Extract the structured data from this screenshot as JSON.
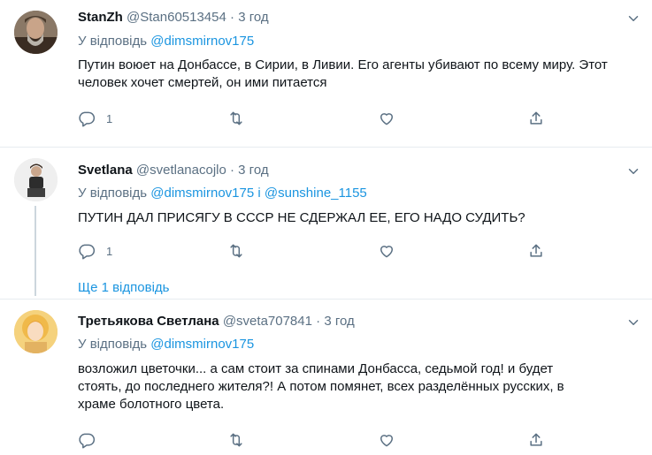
{
  "tweets": [
    {
      "name": "StanZh",
      "handle": "@Stan60513454",
      "sep": "·",
      "time": "3 год",
      "reply_prefix": "У відповідь",
      "reply_to_1": "@dimsmirnov175",
      "text": "Путин воюет на Донбассе, в Сирии, в Ливии. Его агенты убивают по всему миру. Этот человек хочет смертей, он ими питается",
      "reply_count": "1"
    },
    {
      "name": "Svetlana",
      "handle": "@svetlanacojlo",
      "sep": "·",
      "time": "3 год",
      "reply_prefix": "У відповідь",
      "reply_to_1": "@dimsmirnov175",
      "reply_joiner": "і",
      "reply_to_2": "@sunshine_1155",
      "text": "ПУТИН ДАЛ ПРИСЯГУ В СССР НЕ СДЕРЖАЛ ЕЕ, ЕГО НАДО СУДИТЬ?",
      "reply_count": "1"
    },
    {
      "name": "Третьякова Светлана",
      "handle": "@sveta707841",
      "sep": "·",
      "time": "3 год",
      "reply_prefix": "У відповідь",
      "reply_to_1": "@dimsmirnov175",
      "text": "возложил цветочки... а сам стоит за спинами Донбасса, седьмой год! и будет стоять, до последнего жителя?! А потом помянет, всех разделённых русских, в храме болотного цвета.",
      "reply_count": ""
    }
  ],
  "show_more": "Ще 1 відповідь",
  "colors": {
    "accent": "#1b95e0",
    "muted": "#5b7083",
    "divider": "#e6ecf0"
  }
}
